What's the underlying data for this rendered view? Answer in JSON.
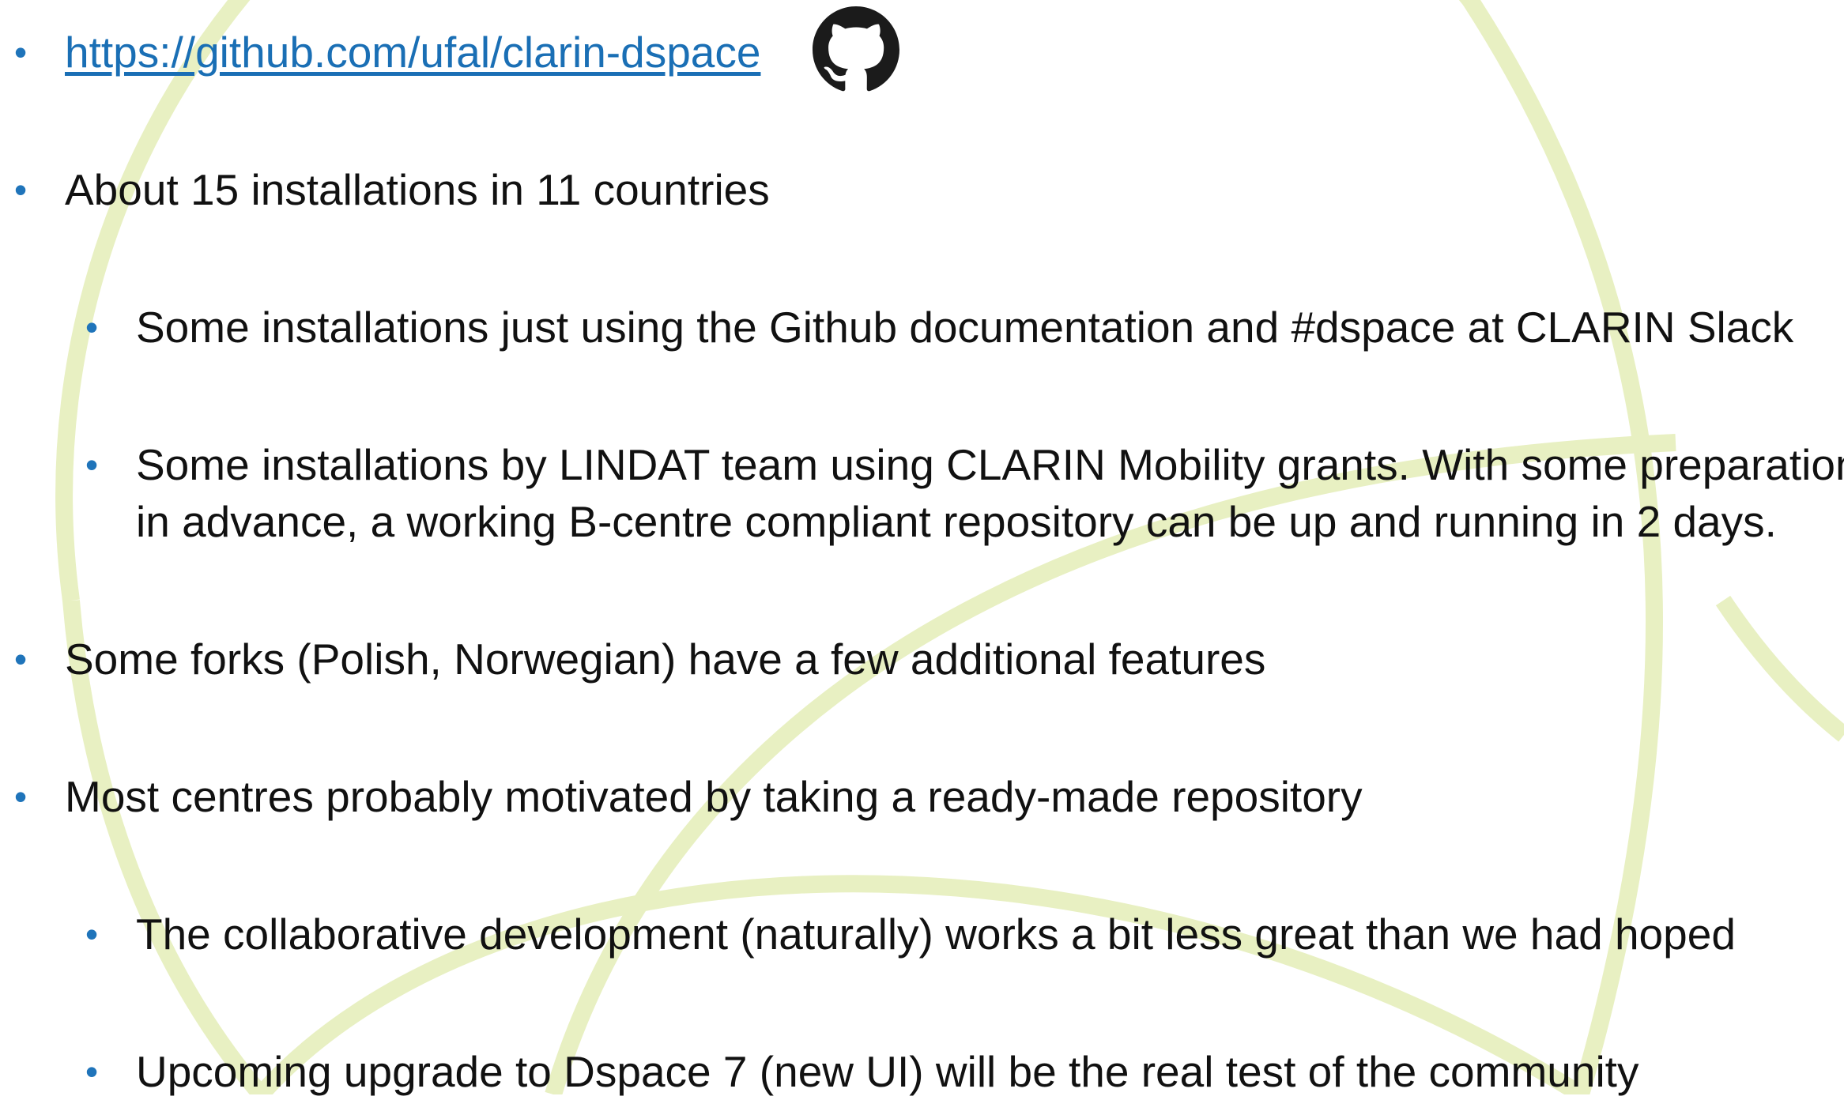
{
  "colors": {
    "bullet": "#1f74ba",
    "link": "#1a6fb5",
    "text": "#111111",
    "arc": "#e8f0c2",
    "github_icon": "#1b1b1b"
  },
  "icons": {
    "github": "github-octocat-icon"
  },
  "bullets": {
    "repo_link": "https://github.com/ufal/clarin-dspace",
    "installations": "About 15 installations in 11 countries",
    "docs_slack": "Some installations just using the Github documentation and #dspace at CLARIN Slack",
    "lindat_line1": "Some installations by LINDAT team using CLARIN Mobility grants. With some preparation",
    "lindat_line2": "in advance, a working B-centre compliant repository can be up and running in 2 days.",
    "forks": "Some forks (Polish, Norwegian) have a few additional features",
    "motivation": "Most centres probably motivated by taking a ready-made repository",
    "collab": "The collaborative development (naturally) works a bit less great than we had hoped",
    "upgrade": "Upcoming upgrade to Dspace 7 (new UI) will be the real test of the community"
  }
}
